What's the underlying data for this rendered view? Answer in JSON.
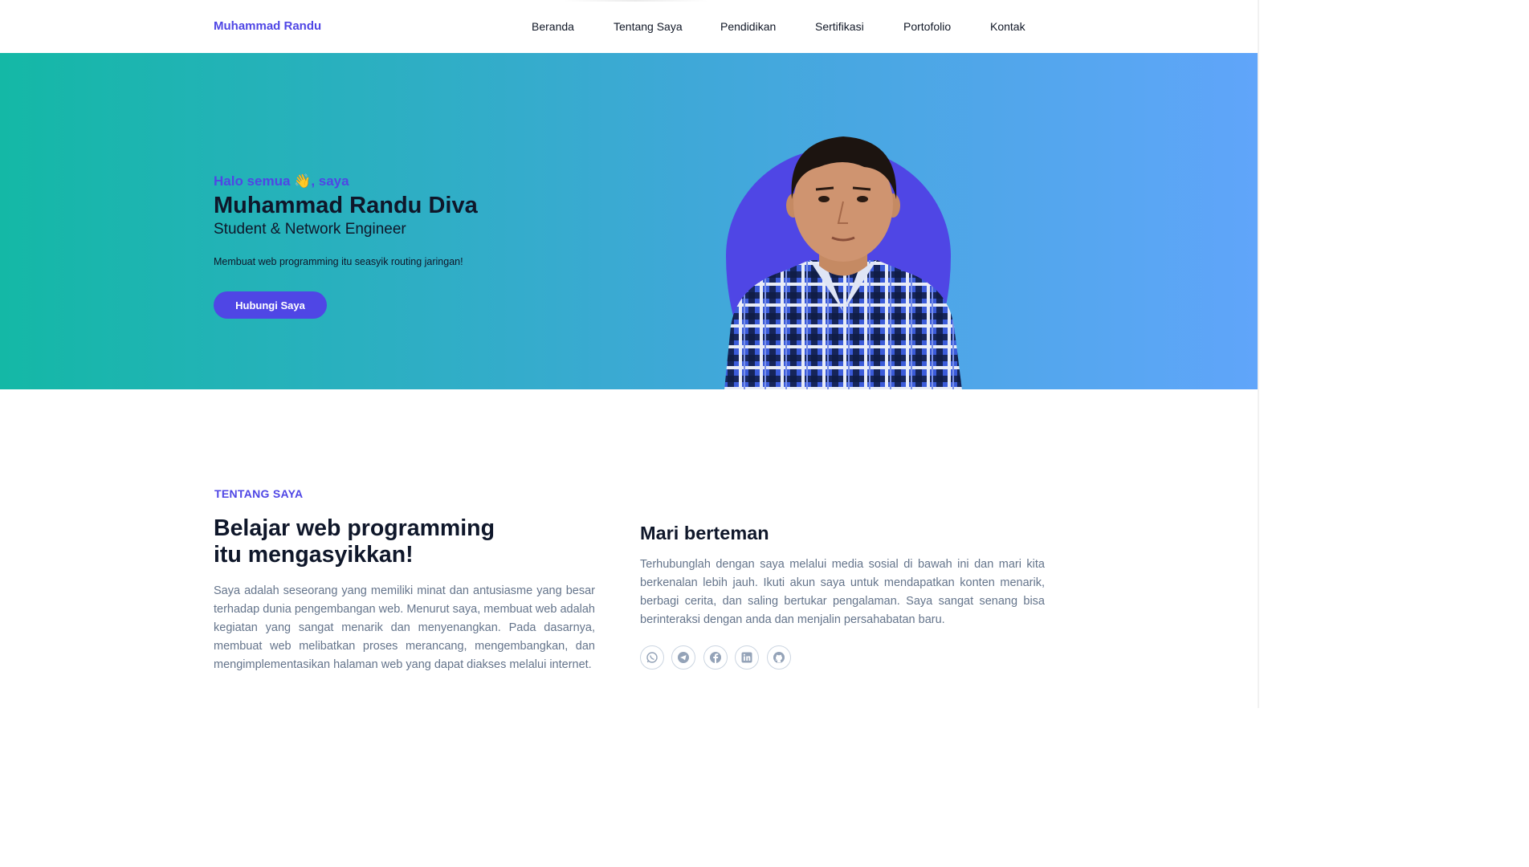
{
  "brand": "Muhammad Randu",
  "nav": {
    "items": [
      {
        "label": "Beranda"
      },
      {
        "label": "Tentang Saya"
      },
      {
        "label": "Pendidikan"
      },
      {
        "label": "Sertifikasi"
      },
      {
        "label": "Portofolio"
      },
      {
        "label": "Kontak"
      }
    ]
  },
  "hero": {
    "greeting": "Halo semua 👋, saya",
    "name": "Muhammad Randu Diva",
    "role": "Student & Network Engineer",
    "tagline": "Membuat web programming itu seasyik routing jaringan!",
    "cta": "Hubungi Saya",
    "accent_color": "#4f46e5",
    "gradient_from": "#14b8a6",
    "gradient_to": "#60a5fa"
  },
  "about": {
    "kicker": "TENTANG SAYA",
    "heading_line1": "Belajar web programming",
    "heading_line2": "itu mengasyikkan!",
    "body": "Saya adalah seseorang yang memiliki minat dan antusiasme yang besar terhadap dunia pengembangan web. Menurut saya, membuat web adalah kegiatan yang sangat menarik dan menyenangkan. Pada dasarnya, membuat web melibatkan proses merancang, mengembangkan, dan mengimplementasikan halaman web yang dapat diakses melalui internet."
  },
  "friends": {
    "heading": "Mari berteman",
    "body": "Terhubunglah dengan saya melalui media sosial di bawah ini dan mari kita berkenalan lebih jauh. Ikuti akun saya untuk mendapatkan konten menarik, berbagi cerita, dan saling bertukar pengalaman. Saya sangat senang bisa berinteraksi dengan anda dan menjalin persahabatan baru.",
    "social_icons": [
      "whatsapp-icon",
      "telegram-icon",
      "facebook-icon",
      "linkedin-icon",
      "github-icon"
    ]
  }
}
